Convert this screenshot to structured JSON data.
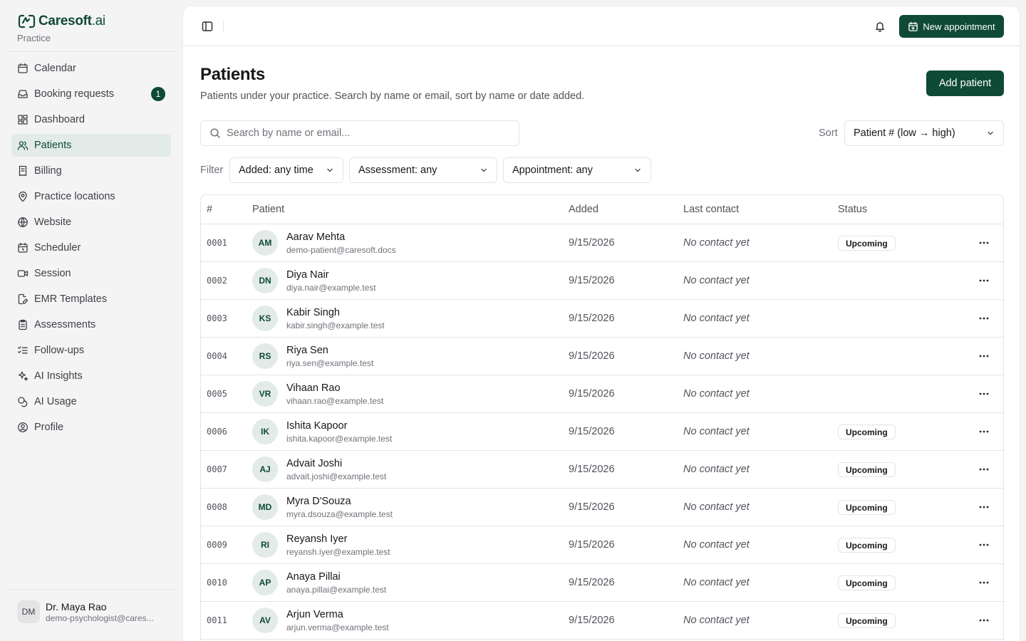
{
  "brand": {
    "name_main": "Caresoft",
    "name_suffix": ".ai",
    "subtitle": "Practice"
  },
  "nav": [
    {
      "label": "Calendar",
      "icon": "calendar-icon",
      "active": false
    },
    {
      "label": "Booking requests",
      "icon": "inbox-icon",
      "active": false,
      "badge": "1"
    },
    {
      "label": "Dashboard",
      "icon": "dashboard-icon",
      "active": false
    },
    {
      "label": "Patients",
      "icon": "users-icon",
      "active": true
    },
    {
      "label": "Billing",
      "icon": "receipt-icon",
      "active": false
    },
    {
      "label": "Practice locations",
      "icon": "map-pin-icon",
      "active": false
    },
    {
      "label": "Website",
      "icon": "globe-icon",
      "active": false
    },
    {
      "label": "Scheduler",
      "icon": "calendar-clock-icon",
      "active": false
    },
    {
      "label": "Session",
      "icon": "video-icon",
      "active": false
    },
    {
      "label": "EMR Templates",
      "icon": "file-edit-icon",
      "active": false
    },
    {
      "label": "Assessments",
      "icon": "clipboard-icon",
      "active": false
    },
    {
      "label": "Follow-ups",
      "icon": "list-checks-icon",
      "active": false
    },
    {
      "label": "AI Insights",
      "icon": "sparkles-icon",
      "active": false
    },
    {
      "label": "AI Usage",
      "icon": "coins-icon",
      "active": false
    },
    {
      "label": "Profile",
      "icon": "user-circle-icon",
      "active": false
    }
  ],
  "user": {
    "initials": "DM",
    "name": "Dr. Maya Rao",
    "email": "demo-psychologist@cares..."
  },
  "topbar": {
    "new_appointment": "New appointment"
  },
  "page": {
    "title": "Patients",
    "description": "Patients under your practice. Search by name or email, sort by name or date added.",
    "add_button": "Add patient"
  },
  "search": {
    "placeholder": "Search by name or email..."
  },
  "sort": {
    "label": "Sort",
    "value": "Patient # (low → high)"
  },
  "filter": {
    "label": "Filter",
    "added": "Added: any time",
    "assessment": "Assessment: any",
    "appointment": "Appointment: any"
  },
  "table": {
    "headers": {
      "num": "#",
      "patient": "Patient",
      "added": "Added",
      "last_contact": "Last contact",
      "status": "Status"
    },
    "rows": [
      {
        "num": "0001",
        "initials": "AM",
        "name": "Aarav Mehta",
        "email": "demo-patient@caresoft.docs",
        "added": "9/15/2026",
        "contact": "No contact yet",
        "status": "Upcoming"
      },
      {
        "num": "0002",
        "initials": "DN",
        "name": "Diya Nair",
        "email": "diya.nair@example.test",
        "added": "9/15/2026",
        "contact": "No contact yet",
        "status": ""
      },
      {
        "num": "0003",
        "initials": "KS",
        "name": "Kabir Singh",
        "email": "kabir.singh@example.test",
        "added": "9/15/2026",
        "contact": "No contact yet",
        "status": ""
      },
      {
        "num": "0004",
        "initials": "RS",
        "name": "Riya Sen",
        "email": "riya.sen@example.test",
        "added": "9/15/2026",
        "contact": "No contact yet",
        "status": ""
      },
      {
        "num": "0005",
        "initials": "VR",
        "name": "Vihaan Rao",
        "email": "vihaan.rao@example.test",
        "added": "9/15/2026",
        "contact": "No contact yet",
        "status": ""
      },
      {
        "num": "0006",
        "initials": "IK",
        "name": "Ishita Kapoor",
        "email": "ishita.kapoor@example.test",
        "added": "9/15/2026",
        "contact": "No contact yet",
        "status": "Upcoming"
      },
      {
        "num": "0007",
        "initials": "AJ",
        "name": "Advait Joshi",
        "email": "advait.joshi@example.test",
        "added": "9/15/2026",
        "contact": "No contact yet",
        "status": "Upcoming"
      },
      {
        "num": "0008",
        "initials": "MD",
        "name": "Myra D'Souza",
        "email": "myra.dsouza@example.test",
        "added": "9/15/2026",
        "contact": "No contact yet",
        "status": "Upcoming"
      },
      {
        "num": "0009",
        "initials": "RI",
        "name": "Reyansh Iyer",
        "email": "reyansh.iyer@example.test",
        "added": "9/15/2026",
        "contact": "No contact yet",
        "status": "Upcoming"
      },
      {
        "num": "0010",
        "initials": "AP",
        "name": "Anaya Pillai",
        "email": "anaya.pillai@example.test",
        "added": "9/15/2026",
        "contact": "No contact yet",
        "status": "Upcoming"
      },
      {
        "num": "0011",
        "initials": "AV",
        "name": "Arjun Verma",
        "email": "arjun.verma@example.test",
        "added": "9/15/2026",
        "contact": "No contact yet",
        "status": "Upcoming"
      }
    ]
  },
  "colors": {
    "brand": "#0f4a36",
    "active_bg": "#e2ebe7",
    "border": "#e4e4e7"
  }
}
